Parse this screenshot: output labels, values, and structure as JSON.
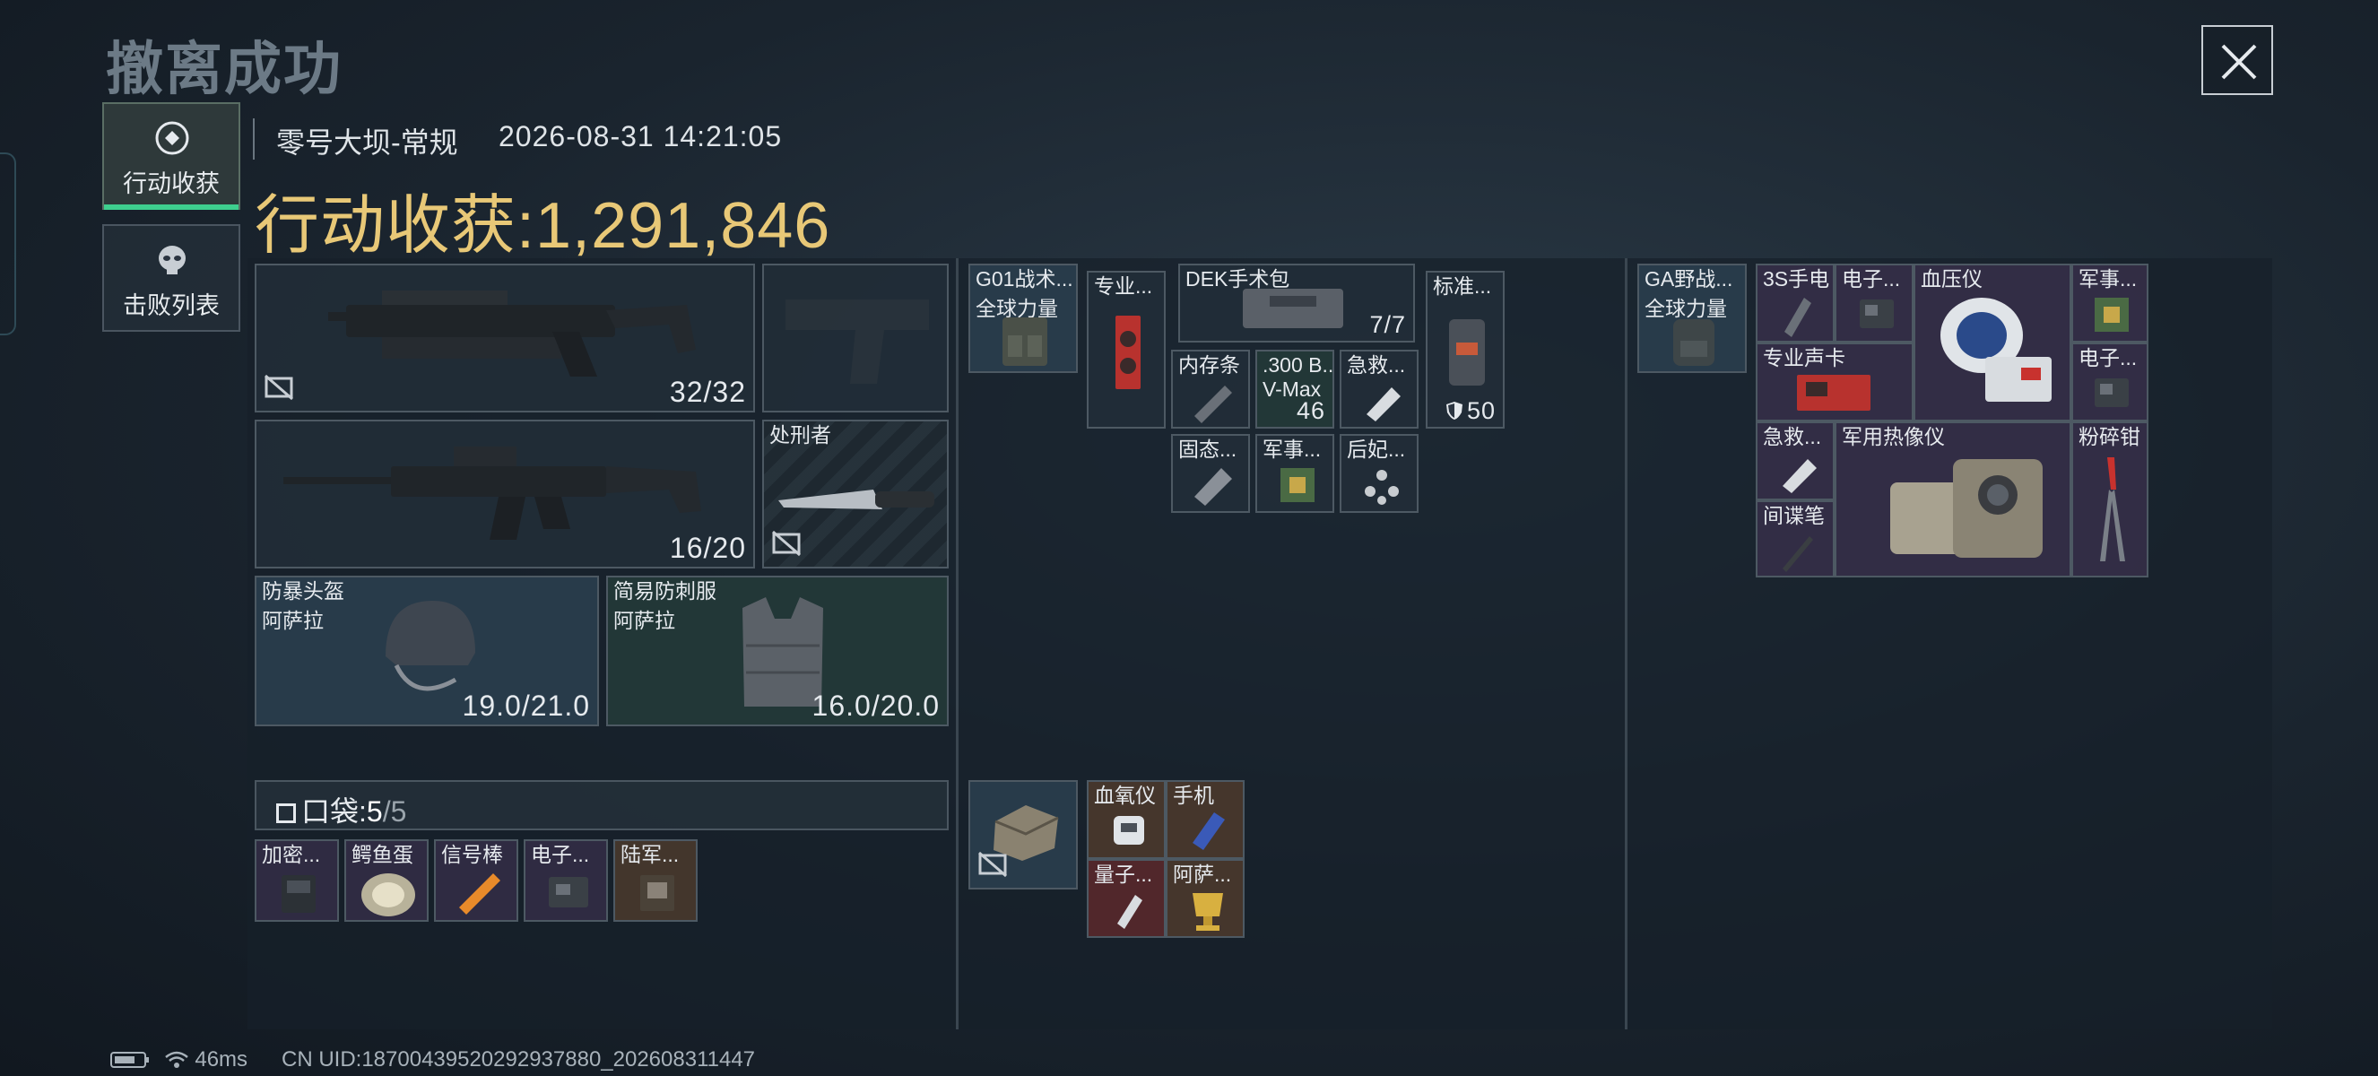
{
  "header": {
    "title": "撤离成功",
    "map_name": "零号大坝-常规",
    "datetime": "2026-08-31 14:21:05",
    "gain_label": "行动收获:",
    "gain_value": "1,291,846"
  },
  "side_tabs": [
    {
      "label": "行动收获",
      "active": true,
      "icon": "operation-loot-icon"
    },
    {
      "label": "击败列表",
      "active": false,
      "icon": "skull-icon"
    }
  ],
  "equipment": {
    "primary_weapon": {
      "ammo": "32/32",
      "icon": "smg-icon"
    },
    "pistol": {
      "icon": "pistol-silhouette-icon"
    },
    "secondary_weapon": {
      "ammo": "16/20",
      "icon": "rifle-icon"
    },
    "melee": {
      "name": "处刑者",
      "icon": "knife-icon"
    },
    "helmet": {
      "name": "防暴头盔",
      "brand": "阿萨拉",
      "durability": "19.0/21.0",
      "icon": "helmet-icon"
    },
    "armor": {
      "name": "简易防刺服",
      "brand": "阿萨拉",
      "durability": "16.0/20.0",
      "icon": "vest-icon"
    }
  },
  "pocket": {
    "label": "口袋:",
    "used": "5",
    "sep": "/",
    "capacity": "5",
    "items": [
      {
        "name": "加密...",
        "icon": "crypto-device-icon"
      },
      {
        "name": "鳄鱼蛋",
        "icon": "egg-icon"
      },
      {
        "name": "信号棒",
        "icon": "flare-icon"
      },
      {
        "name": "电子...",
        "icon": "electronics-icon"
      },
      {
        "name": "陆军...",
        "icon": "army-item-icon"
      }
    ]
  },
  "rig": {
    "name": "G01战术...",
    "sub": "全球力量",
    "items": [
      {
        "name": "专业...",
        "icon": "gpu-icon"
      },
      {
        "name": "DEK手术包",
        "count": "7/7",
        "icon": "medkit-icon"
      },
      {
        "name": "标准...",
        "count": "50",
        "icon": "armor-plate-icon"
      },
      {
        "name": "内存条",
        "icon": "ram-icon"
      },
      {
        "name": ".300 B...",
        "sub": "V-Max",
        "count": "46",
        "icon": "ammo-icon"
      },
      {
        "name": "急救...",
        "icon": "first-aid-icon"
      },
      {
        "name": "固态...",
        "icon": "ssd-icon"
      },
      {
        "name": "军事...",
        "icon": "military-chip-icon"
      },
      {
        "name": "后妃...",
        "icon": "ornament-icon"
      }
    ]
  },
  "safebox": {
    "icon": "safebox-icon",
    "items": [
      {
        "name": "血氧仪",
        "icon": "oximeter-icon"
      },
      {
        "name": "手机",
        "icon": "phone-icon"
      },
      {
        "name": "量子...",
        "icon": "quantum-usb-icon"
      },
      {
        "name": "阿萨...",
        "icon": "golden-cup-icon"
      }
    ]
  },
  "backpack": {
    "name": "GA野战...",
    "sub": "全球力量",
    "items": [
      {
        "name": "3S手电",
        "icon": "flashlight-icon"
      },
      {
        "name": "电子...",
        "icon": "electronics-icon"
      },
      {
        "name": "血压仪",
        "icon": "blood-pressure-icon"
      },
      {
        "name": "军事...",
        "icon": "military-chip-icon"
      },
      {
        "name": "专业声卡",
        "icon": "sound-card-icon"
      },
      {
        "name": "电子...",
        "icon": "electronics-icon"
      },
      {
        "name": "急救...",
        "icon": "first-aid-icon"
      },
      {
        "name": "军用热像仪",
        "icon": "thermal-imager-icon"
      },
      {
        "name": "粉碎钳",
        "icon": "pliers-icon"
      },
      {
        "name": "间谍笔",
        "icon": "spy-pen-icon"
      }
    ]
  },
  "status_bar": {
    "ping": "46ms",
    "uid": "CN UID:18700439520292937880_202608311447"
  },
  "colors": {
    "gain": "#e8c877",
    "active_tab": "#3ecf8e"
  }
}
